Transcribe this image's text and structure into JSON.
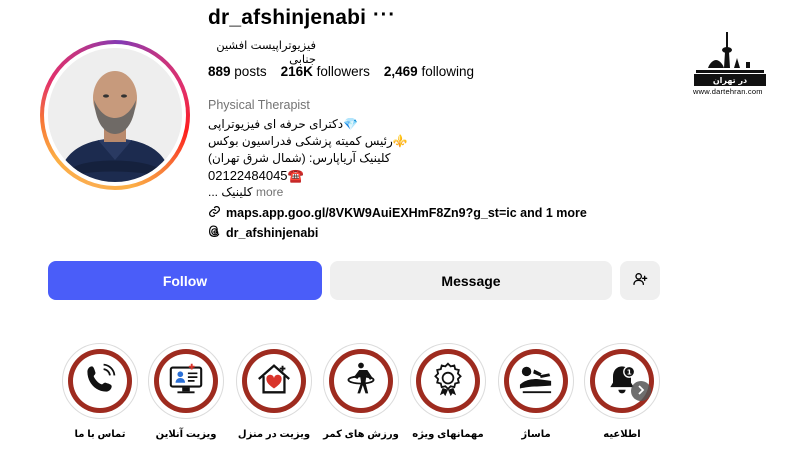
{
  "profile": {
    "username": "dr_afshinjenabi",
    "more_icon": "more-horizontal-icon",
    "full_name": "فیزیوتراپیست افشین جنابی",
    "stats": {
      "posts_value": "889",
      "posts_label": "posts",
      "followers_value": "216K",
      "followers_label": "followers",
      "following_value": "2,469",
      "following_label": "following"
    },
    "category": "Physical Therapist",
    "bio": {
      "line1": "💎دکترای حرفه ای فیزیوتراپی",
      "line2": "⚜️رئیس کمیته پزشکی فدراسیون بوکس",
      "line3": "کلینیک آریاپارس: (شمال شرق تهران)",
      "line4": "02122484045☎️",
      "line5": "کلینیک ...",
      "more": "more"
    },
    "link_text": "maps.app.goo.gl/8VKW9AuiEXHmF8Zn9?g_st=ic and 1 more",
    "threads_handle": "dr_afshinjenabi"
  },
  "actions": {
    "follow_label": "Follow",
    "message_label": "Message",
    "suggest_icon": "add-person-icon"
  },
  "highlights": [
    {
      "label": "تماس با ما",
      "icon": "phone-icon"
    },
    {
      "label": "ویزیت آنلاین",
      "icon": "online-visit-icon"
    },
    {
      "label": "ویزیت در منزل",
      "icon": "home-care-icon"
    },
    {
      "label": "ورزش های کمر",
      "icon": "hula-hoop-icon"
    },
    {
      "label": "مهمانهای ویژه",
      "icon": "badge-icon"
    },
    {
      "label": "ماساژ",
      "icon": "massage-icon"
    },
    {
      "label": "اطلاعیه",
      "icon": "bell-icon"
    }
  ],
  "watermark": {
    "brand_text": "در تهران",
    "url": "www.dartehran.com"
  },
  "colors": {
    "follow_blue": "#4a5df9",
    "highlight_red": "#9e2b1f",
    "muted_gray": "#737373"
  }
}
